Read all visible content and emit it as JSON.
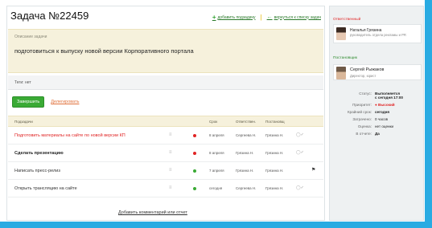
{
  "task": {
    "title": "Задача №22459",
    "links": {
      "add_subtask": "добавить подзадачу",
      "back_to_list": "вернуться к списку задач"
    },
    "description_label": "Описание задачи",
    "description": "подготовиться к выпуску новой версии Корпоративного портала",
    "tags": "Теги: нет"
  },
  "actions": {
    "complete": "Завершить",
    "delegate": "Делегировать"
  },
  "subtasks": {
    "headers": {
      "name": "Подзадачи",
      "deadline": "Срок",
      "responsible": "Ответствен.",
      "creator": "Постановщ"
    },
    "rows": [
      {
        "name": "Подготовить материалы на сайте по новой версии КП",
        "style": "red",
        "status_color": "#e02424",
        "deadline": "8 апреля",
        "responsible": "Сергеева Н.",
        "creator": "Грязина Н.",
        "mark": "◯✓"
      },
      {
        "name": "Сделать презентацию",
        "style": "bold",
        "status_color": "#e02424",
        "deadline": "8 апреля",
        "responsible": "Грязина Н.",
        "creator": "Грязина Н.",
        "mark": "◯✓"
      },
      {
        "name": "Написать пресс-релиз",
        "style": "plain",
        "status_color": "#3aaa35",
        "deadline": "7 апреля",
        "responsible": "Грязина Н.",
        "creator": "Грязина Н.",
        "mark": ""
      },
      {
        "name": "Открыть трансляцию на сайте",
        "style": "plain",
        "status_color": "#3aaa35",
        "deadline": "сегодня",
        "responsible": "Сергеева Н.",
        "creator": "Грязина Н.",
        "mark": "◯✓"
      }
    ]
  },
  "add_comment": "Добавить комментарий или отчет",
  "sidebar": {
    "responsible_title": "Ответственный",
    "responsible": {
      "name": "Наталья Грязина",
      "role": "руководитель отдела рекламы и PR"
    },
    "creator_title": "Постановщик",
    "creator": {
      "name": "Сергей Рыжаков",
      "role": "Директор, юрист"
    },
    "info": [
      {
        "key": "Статус:",
        "value": "Выполняется",
        "value2": "с сегодня 17:00",
        "style": "bold"
      },
      {
        "key": "Приоритет:",
        "value": "● Высокий",
        "style": "red"
      },
      {
        "key": "Крайний срок:",
        "value": "сегодня",
        "style": "bold"
      },
      {
        "key": "Затрачено:",
        "value": "0 часов"
      },
      {
        "key": "Оценка:",
        "value": "нет оценки"
      },
      {
        "key": "В отчете:",
        "value": "Да",
        "style": "bold"
      }
    ]
  },
  "colors": {
    "accent_green": "#3aaa35",
    "alert_red": "#e02424",
    "frame_blue": "#29abe2",
    "desc_bg": "#f6f1dc"
  }
}
